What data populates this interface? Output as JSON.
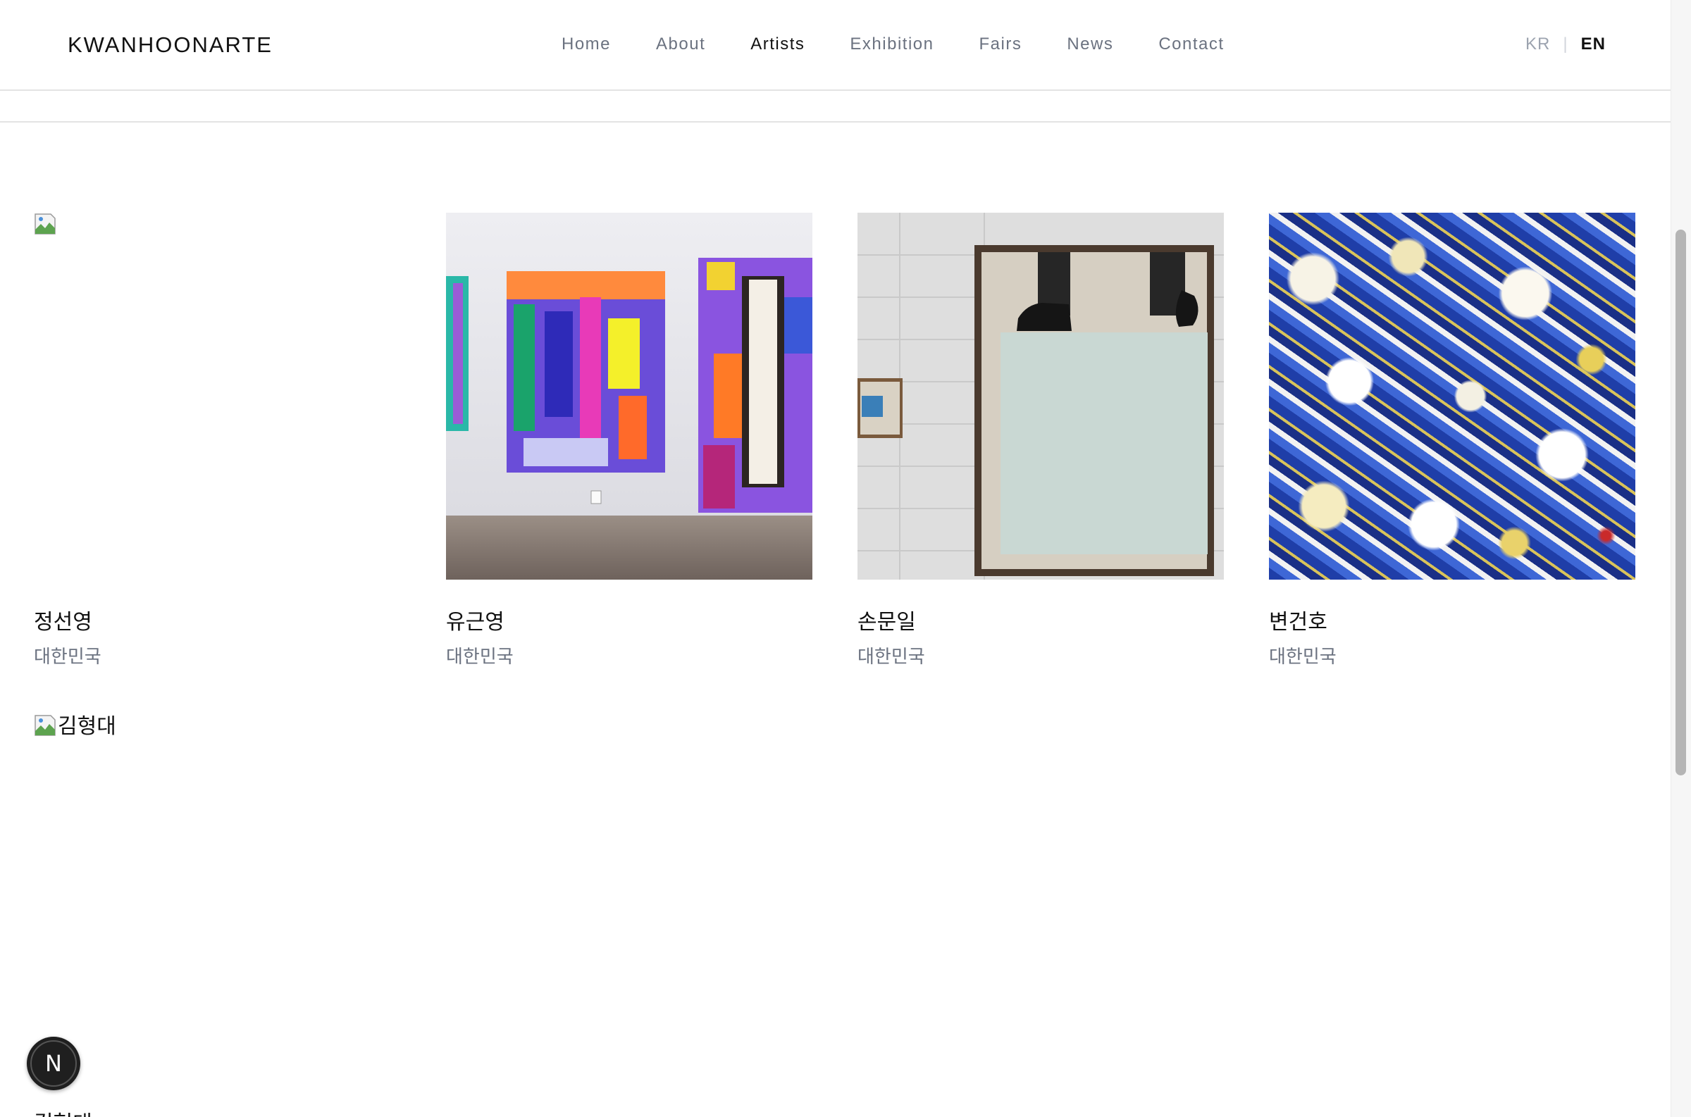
{
  "header": {
    "logo": "KWANHOONARTE",
    "nav": [
      {
        "label": "Home",
        "active": false
      },
      {
        "label": "About",
        "active": false
      },
      {
        "label": "Artists",
        "active": true
      },
      {
        "label": "Exhibition",
        "active": false
      },
      {
        "label": "Fairs",
        "active": false
      },
      {
        "label": "News",
        "active": false
      },
      {
        "label": "Contact",
        "active": false
      }
    ],
    "lang": {
      "kr": "KR",
      "separator": "|",
      "en": "EN"
    }
  },
  "artists": [
    {
      "name": "정선영",
      "country": "대한민국",
      "image": "broken"
    },
    {
      "name": "유근영",
      "country": "대한민국",
      "image": "gallery-installation"
    },
    {
      "name": "손문일",
      "country": "대한민국",
      "image": "framed-painting-with-shoes"
    },
    {
      "name": "변건호",
      "country": "대한민국",
      "image": "blue-abstract-painting"
    },
    {
      "name": "김형대",
      "image_alt": "김형대",
      "image": "broken"
    }
  ],
  "floating_badge": {
    "letter": "N"
  }
}
